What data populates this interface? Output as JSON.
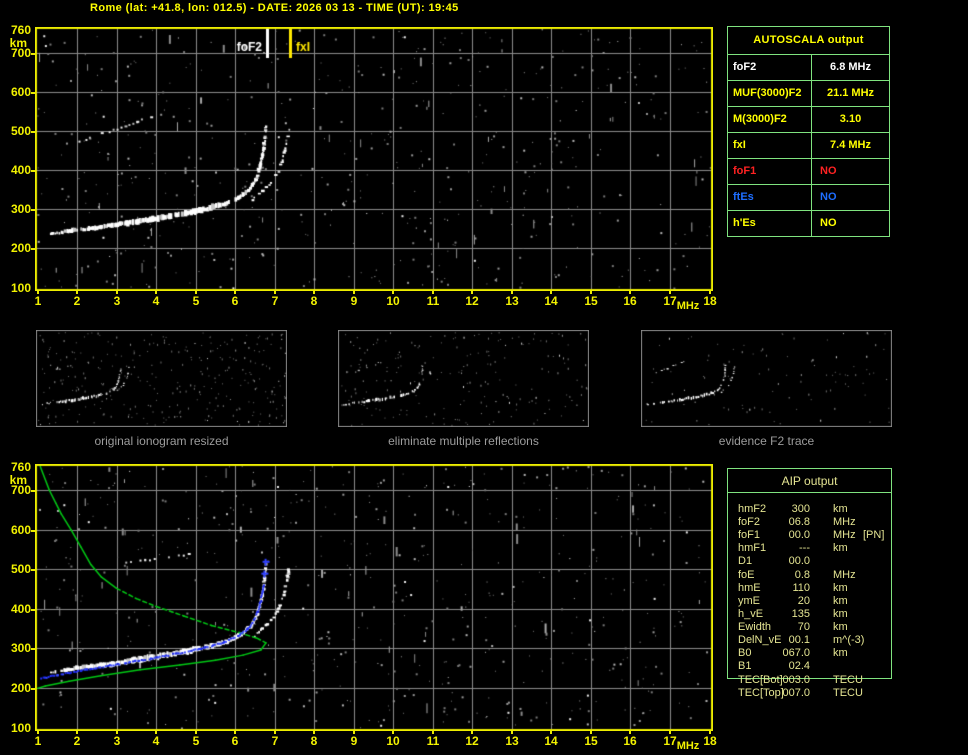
{
  "title": "Rome (lat: +41.8, lon: 012.5) - DATE: 2026 03 13 - TIME (UT): 19:45",
  "colors": {
    "background": "#000000",
    "axis_yellow": "#F2F200",
    "border_yellow": "#EDED00",
    "grid_gray": "#8C8C8C",
    "table_green": "#7FE37F",
    "pale_yellow": "#E4E492",
    "trace_white": "#FFFFFF",
    "profile_green": "#00C814",
    "model_blue": "#2533F0",
    "value_white": "#FFFFFF",
    "value_yellow": "#FFFF00",
    "value_red": "#FF2222",
    "value_blue": "#1E6EFF",
    "thumb_border": "#8A8A8A",
    "thumb_label_gray": "#9C9C9C"
  },
  "autoscala": {
    "header": "AUTOSCALA output",
    "rows": [
      {
        "label": "foF2",
        "value": "6.8 MHz",
        "color": "#FFFFFF",
        "align": "center"
      },
      {
        "label": "MUF(3000)F2",
        "value": "21.1 MHz",
        "color": "#FFFF00",
        "align": "center"
      },
      {
        "label": "M(3000)F2",
        "value": "3.10",
        "color": "#FFFF00",
        "align": "center"
      },
      {
        "label": "fxI",
        "value": "7.4 MHz",
        "color": "#FFFF00",
        "align": "center"
      },
      {
        "label": "foF1",
        "value": "NO",
        "color": "#FF2222",
        "align": "left"
      },
      {
        "label": "ftEs",
        "value": "NO",
        "color": "#1E6EFF",
        "align": "left"
      },
      {
        "label": "h'Es",
        "value": "NO",
        "color": "#FFFF00",
        "align": "left"
      }
    ]
  },
  "aip": {
    "header": "AIP output",
    "rows": [
      {
        "label": "hmF2",
        "value": "300",
        "unit": "km",
        "extra": ""
      },
      {
        "label": "foF2",
        "value": "06.8",
        "unit": "MHz",
        "extra": ""
      },
      {
        "label": "foF1",
        "value": "00.0",
        "unit": "MHz",
        "extra": "[PN]"
      },
      {
        "label": "hmF1",
        "value": "---",
        "unit": "km",
        "extra": ""
      },
      {
        "label": "D1",
        "value": "00.0",
        "unit": "",
        "extra": ""
      },
      {
        "label": "foE",
        "value": "0.8",
        "unit": "MHz",
        "extra": ""
      },
      {
        "label": "hmE",
        "value": "110",
        "unit": "km",
        "extra": ""
      },
      {
        "label": "ymE",
        "value": "20",
        "unit": "km",
        "extra": ""
      },
      {
        "label": "h_vE",
        "value": "135",
        "unit": "km",
        "extra": ""
      },
      {
        "label": "Ewidth",
        "value": "70",
        "unit": "km",
        "extra": ""
      },
      {
        "label": "DelN_vE",
        "value": "00.1",
        "unit": "m^(-3)",
        "extra": ""
      },
      {
        "label": "B0",
        "value": "067.0",
        "unit": "km",
        "extra": ""
      },
      {
        "label": "B1",
        "value": "02.4",
        "unit": "",
        "extra": ""
      },
      {
        "label": "TEC[Bot]",
        "value": "003.0",
        "unit": "TECU",
        "extra": ""
      },
      {
        "label": "TEC[Top]",
        "value": "007.0",
        "unit": "TECU",
        "extra": ""
      }
    ]
  },
  "thumbnails": [
    {
      "label": "original ionogram resized",
      "noise": 300,
      "seed": 21,
      "show_second_hop": true
    },
    {
      "label": "eliminate multiple reflections",
      "noise": 200,
      "seed": 22,
      "show_second_hop": true
    },
    {
      "label": "evidence F2 trace",
      "noise": 95,
      "seed": 23,
      "show_second_hop": true
    }
  ],
  "chart_data": [
    {
      "type": "scatter",
      "name": "scaled ionogram with autoscala markers",
      "xlabel": "MHz",
      "ylabel": "km",
      "xlim": [
        1,
        18
      ],
      "ylim": [
        100,
        760
      ],
      "xticks": [
        1,
        2,
        3,
        4,
        5,
        6,
        7,
        8,
        9,
        10,
        11,
        12,
        13,
        14,
        15,
        16,
        17,
        18
      ],
      "yticks": [
        760,
        700,
        600,
        500,
        400,
        300,
        200,
        100
      ],
      "grid": true,
      "markers": [
        {
          "label": "foF2",
          "freq": 6.8,
          "color": "#FFFFFF",
          "side": "left"
        },
        {
          "label": "fxI",
          "freq": 7.4,
          "color": "#FFE800",
          "side": "right"
        }
      ],
      "traces": {
        "f2_ordinary": [
          [
            1.35,
            237,
            2.5
          ],
          [
            1.8,
            244,
            3.5
          ],
          [
            2.4,
            252,
            4.5
          ],
          [
            3.0,
            261,
            5
          ],
          [
            3.6,
            270,
            5.5
          ],
          [
            4.2,
            280,
            5.5
          ],
          [
            4.8,
            291,
            5.5
          ],
          [
            5.3,
            302,
            5
          ],
          [
            5.8,
            316,
            4.5
          ],
          [
            6.15,
            333,
            4
          ],
          [
            6.4,
            355,
            3.5
          ],
          [
            6.55,
            382,
            3
          ],
          [
            6.65,
            415,
            2.8
          ],
          [
            6.72,
            450,
            2.5
          ],
          [
            6.75,
            478,
            2
          ],
          [
            6.78,
            512,
            2
          ]
        ],
        "f2_extraordinary": [
          [
            6.45,
            325,
            2.2
          ],
          [
            6.7,
            348,
            2.2
          ],
          [
            6.95,
            372,
            2.2
          ],
          [
            7.1,
            398,
            2.2
          ],
          [
            7.2,
            425,
            2.2
          ],
          [
            7.28,
            455,
            2.2
          ],
          [
            7.33,
            485,
            2.2
          ],
          [
            7.36,
            503,
            2.2
          ]
        ],
        "second_hop": [
          [
            1.95,
            470
          ],
          [
            2.3,
            485
          ],
          [
            2.7,
            499
          ],
          [
            3.1,
            512
          ],
          [
            3.5,
            526
          ],
          [
            3.85,
            540
          ]
        ]
      },
      "noise": {
        "dots": 520,
        "streaks": 45,
        "seed": 7
      }
    },
    {
      "type": "scatter",
      "name": "ionogram with restored trace and electron density profile",
      "xlabel": "MHz",
      "ylabel": "km",
      "xlim": [
        1,
        18
      ],
      "ylim": [
        100,
        760
      ],
      "xticks": [
        1,
        2,
        3,
        4,
        5,
        6,
        7,
        8,
        9,
        10,
        11,
        12,
        13,
        14,
        15,
        16,
        17,
        18
      ],
      "yticks": [
        760,
        700,
        600,
        500,
        400,
        300,
        200,
        100
      ],
      "grid": true,
      "markers": [],
      "traces": {
        "f2_ordinary": [
          [
            1.35,
            240,
            2.5
          ],
          [
            1.8,
            247,
            3.5
          ],
          [
            2.4,
            255,
            4.5
          ],
          [
            3.0,
            263,
            5
          ],
          [
            3.6,
            272,
            5.5
          ],
          [
            4.2,
            282,
            5.5
          ],
          [
            4.8,
            293,
            5.5
          ],
          [
            5.3,
            304,
            5
          ],
          [
            5.8,
            318,
            4.5
          ],
          [
            6.15,
            335,
            4
          ],
          [
            6.4,
            357,
            3.5
          ],
          [
            6.55,
            384,
            3
          ],
          [
            6.65,
            416,
            2.8
          ],
          [
            6.72,
            450,
            2.5
          ],
          [
            6.75,
            478,
            2
          ],
          [
            6.78,
            512,
            2
          ]
        ],
        "f2_extraordinary": [
          [
            6.45,
            327,
            2.2
          ],
          [
            6.7,
            350,
            2.2
          ],
          [
            6.95,
            374,
            2.2
          ],
          [
            7.1,
            400,
            2.2
          ],
          [
            7.2,
            426,
            2.2
          ],
          [
            7.28,
            456,
            2.2
          ],
          [
            7.33,
            484,
            2.2
          ],
          [
            7.36,
            500,
            2.2
          ]
        ],
        "second_hop": [
          [
            2.6,
            505
          ],
          [
            3.1,
            515
          ],
          [
            3.7,
            525
          ],
          [
            4.3,
            533
          ],
          [
            4.8,
            540
          ]
        ],
        "model_trace_blue": [
          [
            1.08,
            226
          ],
          [
            1.5,
            236
          ],
          [
            2.2,
            249
          ],
          [
            3.0,
            262
          ],
          [
            3.8,
            276
          ],
          [
            4.6,
            291
          ],
          [
            5.2,
            304
          ],
          [
            5.7,
            318
          ],
          [
            6.05,
            334
          ],
          [
            6.3,
            352
          ],
          [
            6.45,
            372
          ],
          [
            6.55,
            396
          ],
          [
            6.62,
            420
          ],
          [
            6.67,
            445
          ],
          [
            6.7,
            462
          ]
        ],
        "model_lone_points": [
          [
            6.74,
            489
          ],
          [
            6.77,
            519
          ]
        ],
        "electron_density_profile_green": [
          [
            1.07,
            760
          ],
          [
            1.3,
            700
          ],
          [
            1.6,
            640
          ],
          [
            1.85,
            600
          ],
          [
            2.1,
            556
          ],
          [
            2.35,
            512
          ],
          [
            2.62,
            480
          ],
          [
            3.0,
            452
          ],
          [
            3.5,
            426
          ],
          [
            4.0,
            406
          ],
          [
            4.7,
            382
          ],
          [
            5.4,
            358
          ],
          [
            6.1,
            340
          ],
          [
            6.55,
            326
          ],
          [
            6.78,
            314
          ],
          [
            6.65,
            296
          ],
          [
            6.2,
            283
          ],
          [
            5.5,
            270
          ],
          [
            4.6,
            258
          ],
          [
            3.6,
            246
          ],
          [
            2.6,
            231
          ],
          [
            1.8,
            217
          ],
          [
            1.2,
            205
          ],
          [
            1.0,
            199
          ]
        ]
      },
      "noise": {
        "dots": 540,
        "streaks": 45,
        "seed": 13
      }
    }
  ]
}
